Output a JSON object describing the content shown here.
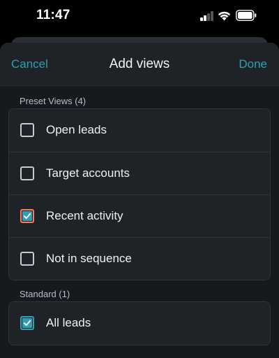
{
  "status": {
    "time": "11:47"
  },
  "header": {
    "cancel_label": "Cancel",
    "title": "Add views",
    "done_label": "Done"
  },
  "preset": {
    "section_label": "Preset Views (4)",
    "items": [
      {
        "label": "Open leads",
        "checked": false
      },
      {
        "label": "Target accounts",
        "checked": false
      },
      {
        "label": "Recent activity",
        "checked": true
      },
      {
        "label": "Not in sequence",
        "checked": false
      }
    ]
  },
  "standard": {
    "section_label": "Standard (1)",
    "items": [
      {
        "label": "All leads",
        "checked": true
      }
    ]
  },
  "colors": {
    "accent": "#2e9fb5",
    "focus_ring": "#ff7a59",
    "sheet_bg": "#16191e",
    "card_bg": "#1f2328"
  },
  "icons": {
    "signal": "cellular-signal-icon",
    "wifi": "wifi-icon",
    "battery": "battery-icon",
    "check": "checkmark-icon"
  }
}
